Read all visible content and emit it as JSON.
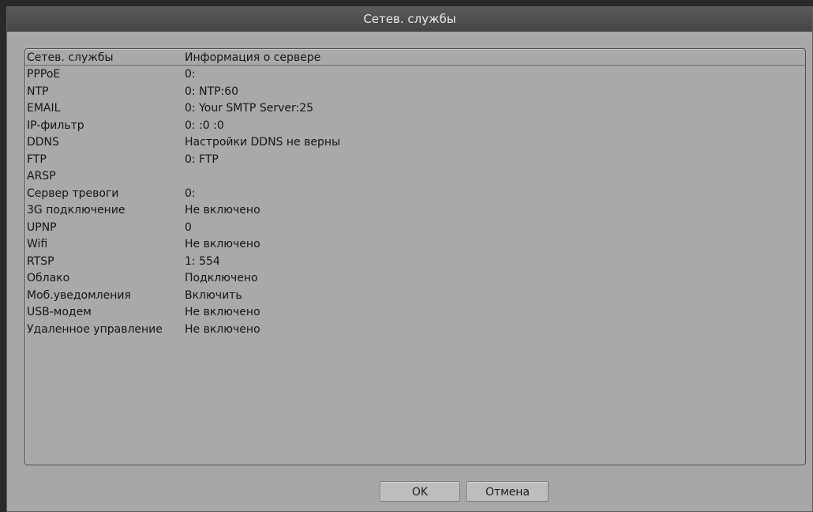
{
  "window": {
    "title": "Сетев. службы"
  },
  "table": {
    "headers": {
      "service": "Сетев. службы",
      "info": "Информация о сервере"
    },
    "rows": [
      {
        "service": "PPPoE",
        "info": "0:"
      },
      {
        "service": "NTP",
        "info": "0: NTP:60"
      },
      {
        "service": "EMAIL",
        "info": "0: Your SMTP Server:25"
      },
      {
        "service": "IP-фильтр",
        "info": "0: :0 :0"
      },
      {
        "service": "DDNS",
        "info": "Настройки DDNS не верны"
      },
      {
        "service": "FTP",
        "info": "0: FTP"
      },
      {
        "service": "ARSP",
        "info": ""
      },
      {
        "service": "Сервер тревоги",
        "info": "0:"
      },
      {
        "service": "3G подключение",
        "info": "Не включено"
      },
      {
        "service": "UPNP",
        "info": "0"
      },
      {
        "service": "Wifi",
        "info": "Не включено"
      },
      {
        "service": "RTSP",
        "info": "1: 554"
      },
      {
        "service": "Облако",
        "info": "Подключено"
      },
      {
        "service": "Моб.уведомления",
        "info": "Включить"
      },
      {
        "service": "USB-модем",
        "info": "Не включено"
      },
      {
        "service": "Удаленное управление",
        "info": "Не включено"
      }
    ]
  },
  "buttons": {
    "ok": "OK",
    "cancel": "Отмена"
  }
}
